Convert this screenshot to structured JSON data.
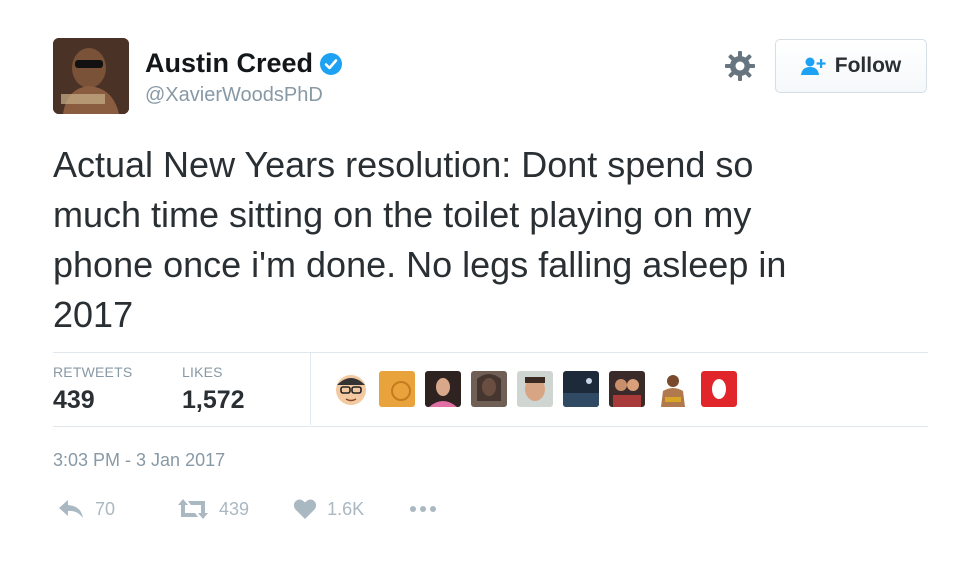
{
  "author": {
    "display_name": "Austin Creed",
    "handle": "@XavierWoodsPhD",
    "verified": true,
    "avatar_icon": "profile-photo"
  },
  "header": {
    "follow_label": "Follow",
    "gear_icon": "gear-icon"
  },
  "tweet": {
    "text": "Actual New Years resolution: Dont spend so\nmuch time sitting on the toilet playing on my\nphone once i'm done. No legs falling asleep in\n2017"
  },
  "stats": {
    "retweets_label": "RETWEETS",
    "retweets_value": "439",
    "likes_label": "LIKES",
    "likes_value": "1,572"
  },
  "timestamp": "3:03 PM - 3 Jan 2017",
  "actions": {
    "reply_count": "70",
    "retweet_count": "439",
    "like_count": "1.6K"
  },
  "colors": {
    "verified_blue": "#1da1f2",
    "muted_gray": "#8899a6",
    "icon_gray": "#aab8c2"
  }
}
